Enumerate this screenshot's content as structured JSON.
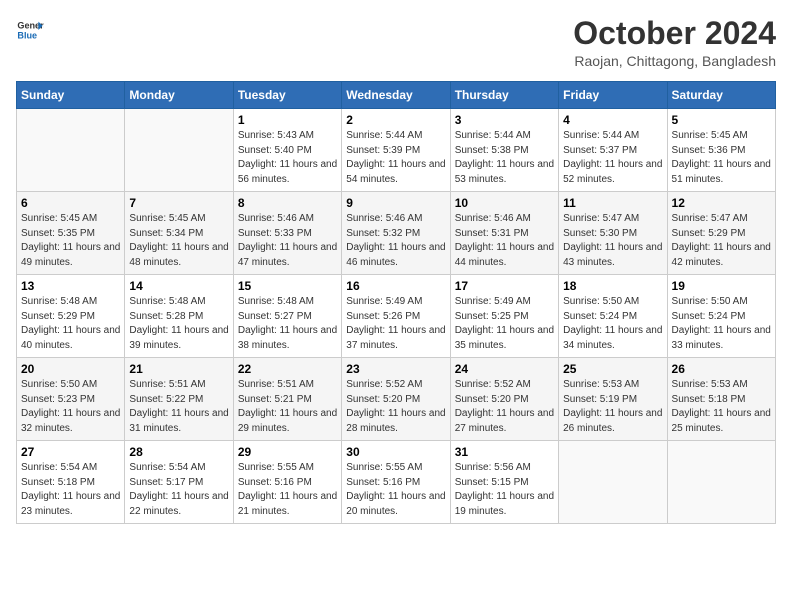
{
  "logo": {
    "line1": "General",
    "line2": "Blue"
  },
  "title": "October 2024",
  "subtitle": "Raojan, Chittagong, Bangladesh",
  "weekdays": [
    "Sunday",
    "Monday",
    "Tuesday",
    "Wednesday",
    "Thursday",
    "Friday",
    "Saturday"
  ],
  "weeks": [
    [
      {
        "day": "",
        "info": ""
      },
      {
        "day": "",
        "info": ""
      },
      {
        "day": "1",
        "info": "Sunrise: 5:43 AM\nSunset: 5:40 PM\nDaylight: 11 hours and 56 minutes."
      },
      {
        "day": "2",
        "info": "Sunrise: 5:44 AM\nSunset: 5:39 PM\nDaylight: 11 hours and 54 minutes."
      },
      {
        "day": "3",
        "info": "Sunrise: 5:44 AM\nSunset: 5:38 PM\nDaylight: 11 hours and 53 minutes."
      },
      {
        "day": "4",
        "info": "Sunrise: 5:44 AM\nSunset: 5:37 PM\nDaylight: 11 hours and 52 minutes."
      },
      {
        "day": "5",
        "info": "Sunrise: 5:45 AM\nSunset: 5:36 PM\nDaylight: 11 hours and 51 minutes."
      }
    ],
    [
      {
        "day": "6",
        "info": "Sunrise: 5:45 AM\nSunset: 5:35 PM\nDaylight: 11 hours and 49 minutes."
      },
      {
        "day": "7",
        "info": "Sunrise: 5:45 AM\nSunset: 5:34 PM\nDaylight: 11 hours and 48 minutes."
      },
      {
        "day": "8",
        "info": "Sunrise: 5:46 AM\nSunset: 5:33 PM\nDaylight: 11 hours and 47 minutes."
      },
      {
        "day": "9",
        "info": "Sunrise: 5:46 AM\nSunset: 5:32 PM\nDaylight: 11 hours and 46 minutes."
      },
      {
        "day": "10",
        "info": "Sunrise: 5:46 AM\nSunset: 5:31 PM\nDaylight: 11 hours and 44 minutes."
      },
      {
        "day": "11",
        "info": "Sunrise: 5:47 AM\nSunset: 5:30 PM\nDaylight: 11 hours and 43 minutes."
      },
      {
        "day": "12",
        "info": "Sunrise: 5:47 AM\nSunset: 5:29 PM\nDaylight: 11 hours and 42 minutes."
      }
    ],
    [
      {
        "day": "13",
        "info": "Sunrise: 5:48 AM\nSunset: 5:29 PM\nDaylight: 11 hours and 40 minutes."
      },
      {
        "day": "14",
        "info": "Sunrise: 5:48 AM\nSunset: 5:28 PM\nDaylight: 11 hours and 39 minutes."
      },
      {
        "day": "15",
        "info": "Sunrise: 5:48 AM\nSunset: 5:27 PM\nDaylight: 11 hours and 38 minutes."
      },
      {
        "day": "16",
        "info": "Sunrise: 5:49 AM\nSunset: 5:26 PM\nDaylight: 11 hours and 37 minutes."
      },
      {
        "day": "17",
        "info": "Sunrise: 5:49 AM\nSunset: 5:25 PM\nDaylight: 11 hours and 35 minutes."
      },
      {
        "day": "18",
        "info": "Sunrise: 5:50 AM\nSunset: 5:24 PM\nDaylight: 11 hours and 34 minutes."
      },
      {
        "day": "19",
        "info": "Sunrise: 5:50 AM\nSunset: 5:24 PM\nDaylight: 11 hours and 33 minutes."
      }
    ],
    [
      {
        "day": "20",
        "info": "Sunrise: 5:50 AM\nSunset: 5:23 PM\nDaylight: 11 hours and 32 minutes."
      },
      {
        "day": "21",
        "info": "Sunrise: 5:51 AM\nSunset: 5:22 PM\nDaylight: 11 hours and 31 minutes."
      },
      {
        "day": "22",
        "info": "Sunrise: 5:51 AM\nSunset: 5:21 PM\nDaylight: 11 hours and 29 minutes."
      },
      {
        "day": "23",
        "info": "Sunrise: 5:52 AM\nSunset: 5:20 PM\nDaylight: 11 hours and 28 minutes."
      },
      {
        "day": "24",
        "info": "Sunrise: 5:52 AM\nSunset: 5:20 PM\nDaylight: 11 hours and 27 minutes."
      },
      {
        "day": "25",
        "info": "Sunrise: 5:53 AM\nSunset: 5:19 PM\nDaylight: 11 hours and 26 minutes."
      },
      {
        "day": "26",
        "info": "Sunrise: 5:53 AM\nSunset: 5:18 PM\nDaylight: 11 hours and 25 minutes."
      }
    ],
    [
      {
        "day": "27",
        "info": "Sunrise: 5:54 AM\nSunset: 5:18 PM\nDaylight: 11 hours and 23 minutes."
      },
      {
        "day": "28",
        "info": "Sunrise: 5:54 AM\nSunset: 5:17 PM\nDaylight: 11 hours and 22 minutes."
      },
      {
        "day": "29",
        "info": "Sunrise: 5:55 AM\nSunset: 5:16 PM\nDaylight: 11 hours and 21 minutes."
      },
      {
        "day": "30",
        "info": "Sunrise: 5:55 AM\nSunset: 5:16 PM\nDaylight: 11 hours and 20 minutes."
      },
      {
        "day": "31",
        "info": "Sunrise: 5:56 AM\nSunset: 5:15 PM\nDaylight: 11 hours and 19 minutes."
      },
      {
        "day": "",
        "info": ""
      },
      {
        "day": "",
        "info": ""
      }
    ]
  ]
}
